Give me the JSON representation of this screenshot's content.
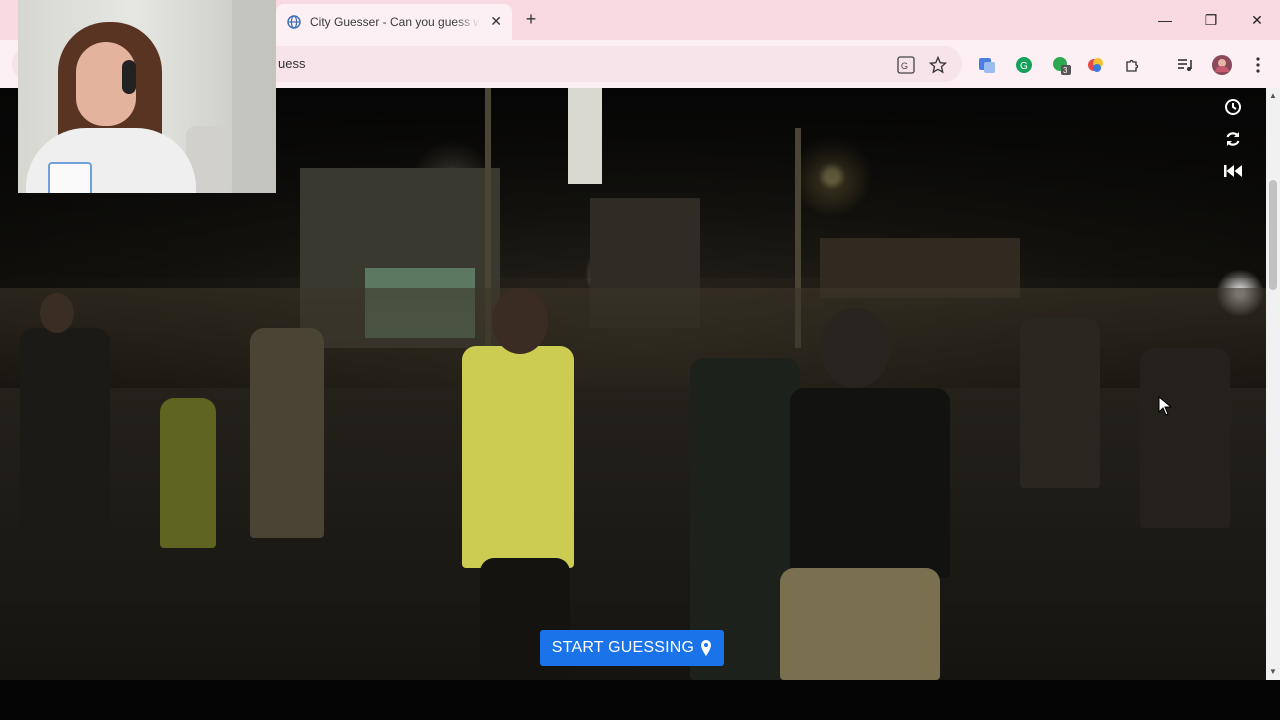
{
  "browser": {
    "tab_title": "City Guesser - Can you guess w",
    "new_tab_symbol": "+",
    "close_tab_symbol": "✕",
    "address_text": "uess",
    "window_controls": {
      "minimize": "—",
      "restore": "❐",
      "close": "✕"
    },
    "extension_badge": "3"
  },
  "page": {
    "start_button_label": "START GUESSING",
    "side_icons": [
      "clock-icon",
      "refresh-icon",
      "skip-back-icon"
    ]
  },
  "colors": {
    "tab_strip": "#f9d9e2",
    "toolbar": "#fdf0f4",
    "accent_button": "#1a73e8"
  }
}
